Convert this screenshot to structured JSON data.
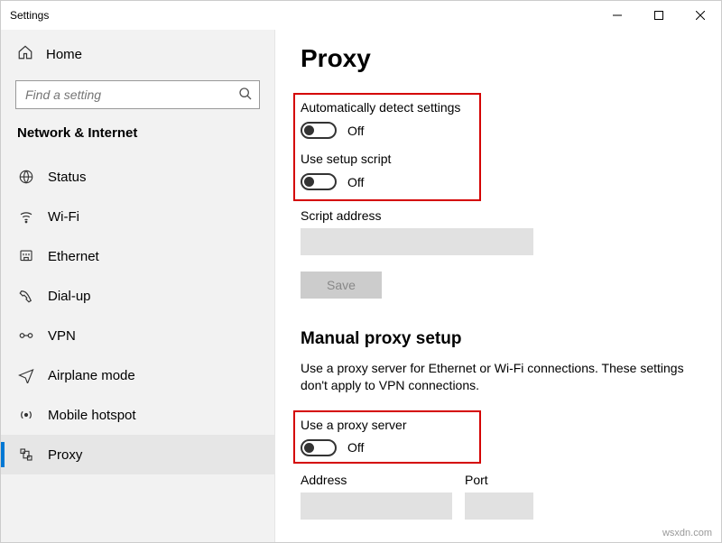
{
  "window": {
    "title": "Settings"
  },
  "sidebar": {
    "home": "Home",
    "search_placeholder": "Find a setting",
    "section": "Network & Internet",
    "items": [
      {
        "label": "Status",
        "icon": "status"
      },
      {
        "label": "Wi-Fi",
        "icon": "wifi"
      },
      {
        "label": "Ethernet",
        "icon": "ethernet"
      },
      {
        "label": "Dial-up",
        "icon": "dialup"
      },
      {
        "label": "VPN",
        "icon": "vpn"
      },
      {
        "label": "Airplane mode",
        "icon": "airplane"
      },
      {
        "label": "Mobile hotspot",
        "icon": "hotspot"
      },
      {
        "label": "Proxy",
        "icon": "proxy",
        "selected": true
      }
    ]
  },
  "main": {
    "title": "Proxy",
    "auto_detect_label": "Automatically detect settings",
    "auto_detect_state": "Off",
    "setup_script_label": "Use setup script",
    "setup_script_state": "Off",
    "script_address_label": "Script address",
    "save_label": "Save",
    "manual_title": "Manual proxy setup",
    "manual_desc": "Use a proxy server for Ethernet or Wi-Fi connections. These settings don't apply to VPN connections.",
    "use_proxy_label": "Use a proxy server",
    "use_proxy_state": "Off",
    "address_label": "Address",
    "port_label": "Port"
  },
  "watermark": "wsxdn.com"
}
